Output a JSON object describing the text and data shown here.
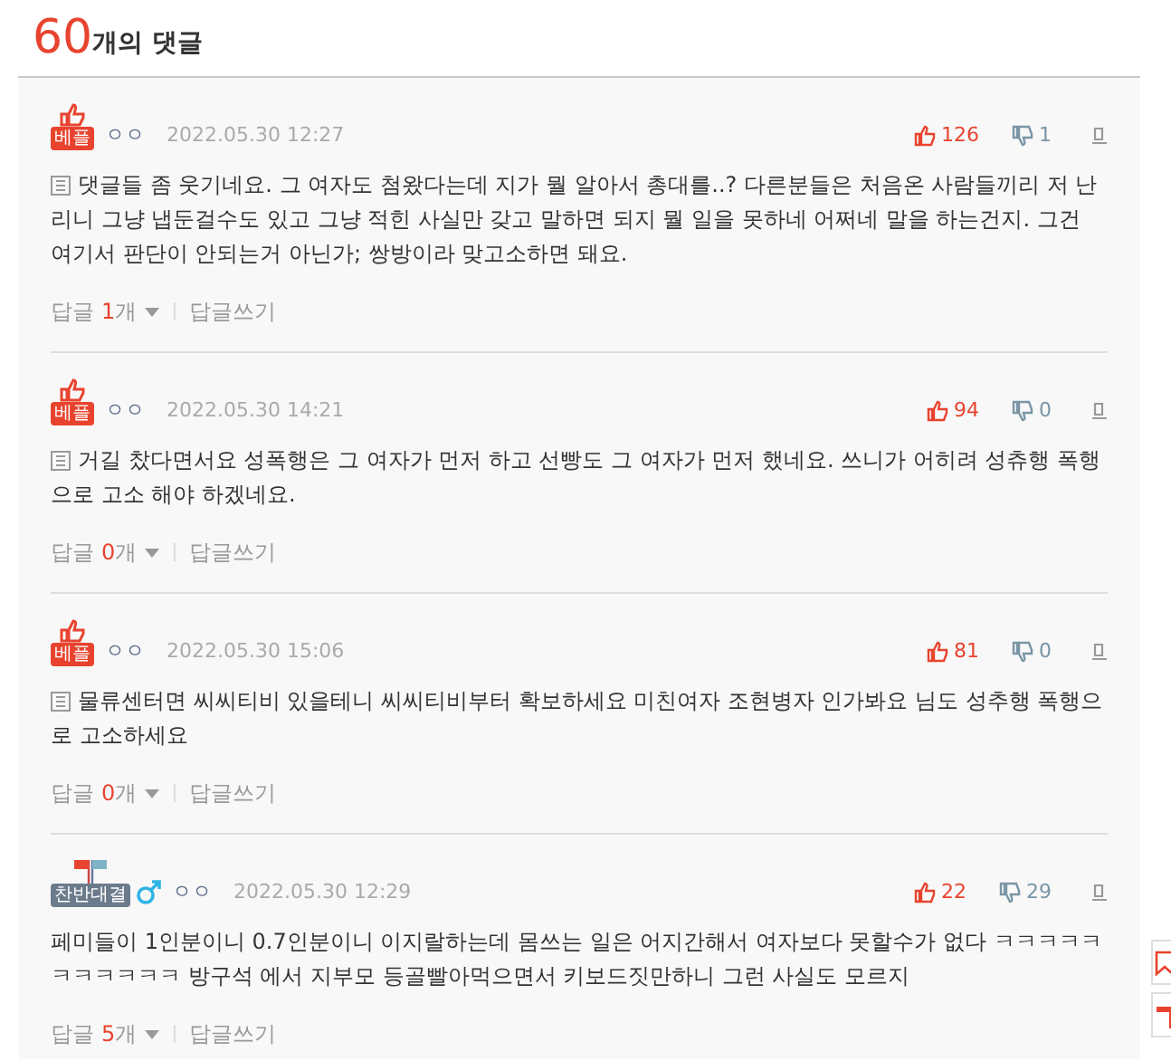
{
  "header": {
    "count": "60",
    "label": "개의 댓글"
  },
  "comments": [
    {
      "kind": "best",
      "badge": "베플",
      "male": false,
      "author": "ㅇㅇ",
      "date": "2022.05.30 12:27",
      "likes": "126",
      "dislikes": "1",
      "text": "댓글들 좀 웃기네요. 그 여자도 첨왔다는데 지가 뭘 알아서 총대를..? 다른분들은 처음온 사람들끼리 저 난리니 그냥 냅둔걸수도 있고 그냥 적힌 사실만 갖고 말하면 되지 뭘 일을 못하네 어쩌네 말을 하는건지. 그건 여기서 판단이 안되는거 아닌가; 쌍방이라 맞고소하면 돼요.",
      "reply_label": "답글",
      "reply_count": "1",
      "reply_unit": "개",
      "write_label": "답글쓰기"
    },
    {
      "kind": "best",
      "badge": "베플",
      "male": false,
      "author": "ㅇㅇ",
      "date": "2022.05.30 14:21",
      "likes": "94",
      "dislikes": "0",
      "text": "거길 찼다면서요 성폭행은 그 여자가 먼저 하고 선빵도 그 여자가 먼저 했네요. 쓰니가 어히려 성츄행 폭행으로 고소 해야 하겠네요.",
      "reply_label": "답글",
      "reply_count": "0",
      "reply_unit": "개",
      "write_label": "답글쓰기"
    },
    {
      "kind": "best",
      "badge": "베플",
      "male": false,
      "author": "ㅇㅇ",
      "date": "2022.05.30 15:06",
      "likes": "81",
      "dislikes": "0",
      "text": "물류센터면 씨씨티비 있을테니 씨씨티비부터 확보하세요 미친여자 조현병자 인가봐요 님도 성추행 폭행으로 고소하세요",
      "reply_label": "답글",
      "reply_count": "0",
      "reply_unit": "개",
      "write_label": "답글쓰기"
    },
    {
      "kind": "debate",
      "badge": "찬반대결",
      "male": true,
      "author": "ㅇㅇ",
      "date": "2022.05.30 12:29",
      "likes": "22",
      "dislikes": "29",
      "text": "페미들이 1인분이니 0.7인분이니 이지랄하는데 몸쓰는 일은 어지간해서 여자보다 못할수가 없다 ㅋㅋㅋㅋㅋㅋㅋㅋㅋㅋㅋ 방구석 에서 지부모 등골빨아먹으면서 키보드짓만하니 그런 사실도 모르지",
      "reply_label": "답글",
      "reply_count": "5",
      "reply_unit": "개",
      "write_label": "답글쓰기"
    }
  ]
}
